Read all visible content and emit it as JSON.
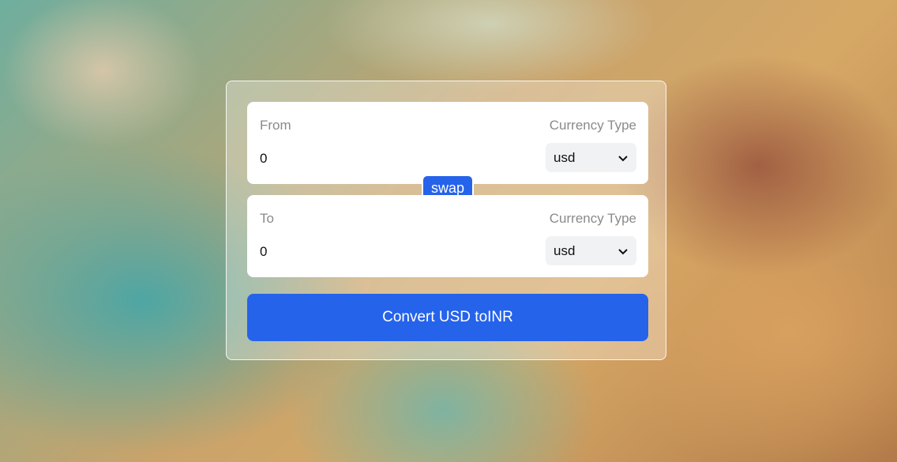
{
  "colors": {
    "accent": "#2563eb",
    "card_border": "#ffffff"
  },
  "from": {
    "label": "From",
    "currency_label": "Currency Type",
    "amount": "0",
    "currency": "usd"
  },
  "swap_label": "swap",
  "to": {
    "label": "To",
    "currency_label": "Currency Type",
    "amount": "0",
    "currency": "usd"
  },
  "convert_label": "Convert USD toINR"
}
